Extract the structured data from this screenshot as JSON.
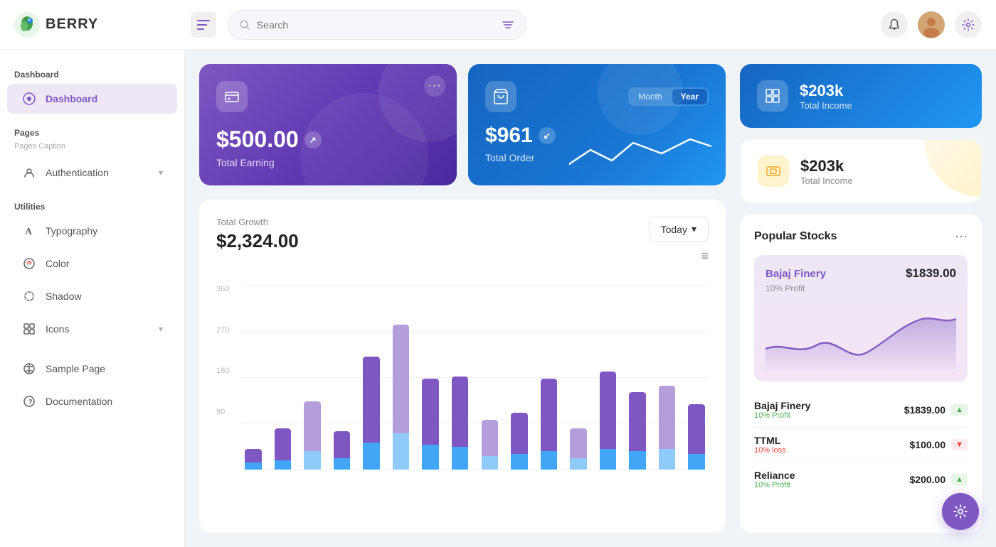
{
  "header": {
    "logo_text": "BERRY",
    "search_placeholder": "Search",
    "menu_icon": "☰"
  },
  "sidebar": {
    "section1_label": "Dashboard",
    "dashboard_item": "Dashboard",
    "pages_label": "Pages",
    "pages_caption": "Pages Caption",
    "authentication_item": "Authentication",
    "utilities_label": "Utilities",
    "typography_item": "Typography",
    "color_item": "Color",
    "shadow_item": "Shadow",
    "icons_item": "Icons",
    "sample_page_item": "Sample Page",
    "documentation_item": "Documentation"
  },
  "cards": {
    "earning_amount": "$500.00",
    "earning_label": "Total Earning",
    "order_amount": "$961",
    "order_label": "Total Order",
    "month_label": "Month",
    "year_label": "Year",
    "income1_amount": "$203k",
    "income1_label": "Total Income",
    "income2_amount": "$203k",
    "income2_label": "Total Income"
  },
  "chart": {
    "title": "Total Growth",
    "amount": "$2,324.00",
    "today_label": "Today",
    "y_labels": [
      "360",
      "270",
      "180",
      "90"
    ],
    "bars": [
      {
        "purple": 30,
        "blue": 15
      },
      {
        "purple": 70,
        "blue": 20
      },
      {
        "purple": 110,
        "blue": 40
      },
      {
        "purple": 60,
        "blue": 25
      },
      {
        "purple": 190,
        "blue": 60
      },
      {
        "purple": 240,
        "blue": 80
      },
      {
        "purple": 145,
        "blue": 55
      },
      {
        "purple": 155,
        "blue": 50
      },
      {
        "purple": 80,
        "blue": 30
      },
      {
        "purple": 90,
        "blue": 35
      },
      {
        "purple": 160,
        "blue": 40
      },
      {
        "purple": 65,
        "blue": 25
      },
      {
        "purple": 170,
        "blue": 45
      },
      {
        "purple": 130,
        "blue": 40
      },
      {
        "purple": 140,
        "blue": 45
      },
      {
        "purple": 110,
        "blue": 35
      }
    ]
  },
  "stocks": {
    "section_title": "Popular Stocks",
    "featured_name": "Bajaj Finery",
    "featured_price": "$1839.00",
    "featured_profit": "10% Profit",
    "list": [
      {
        "name": "Bajaj Finery",
        "price": "$1839.00",
        "profit": "10% Profit",
        "trend": "up"
      },
      {
        "name": "TTML",
        "price": "$100.00",
        "profit": "10% loss",
        "trend": "down"
      },
      {
        "name": "Reliance",
        "price": "$200.00",
        "profit": "10% Profit",
        "trend": "up"
      }
    ]
  },
  "fab_icon": "⚙"
}
